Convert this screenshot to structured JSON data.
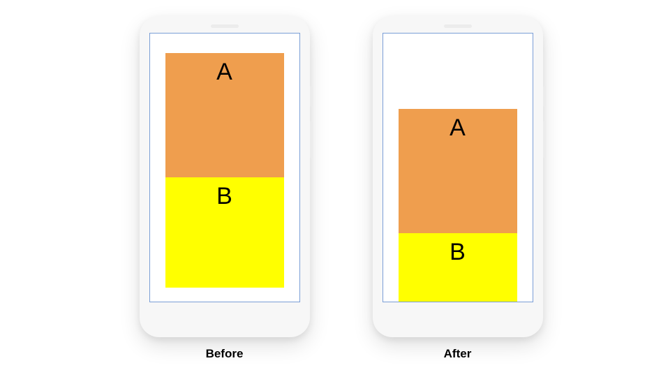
{
  "blocks": {
    "a_label": "A",
    "b_label": "B"
  },
  "captions": {
    "before": "Before",
    "after": "After"
  },
  "colors": {
    "blockA": "#ef9e4e",
    "blockB": "#ffff00",
    "screen_border": "#7a9ed6",
    "phone_body": "#f7f7f7"
  }
}
